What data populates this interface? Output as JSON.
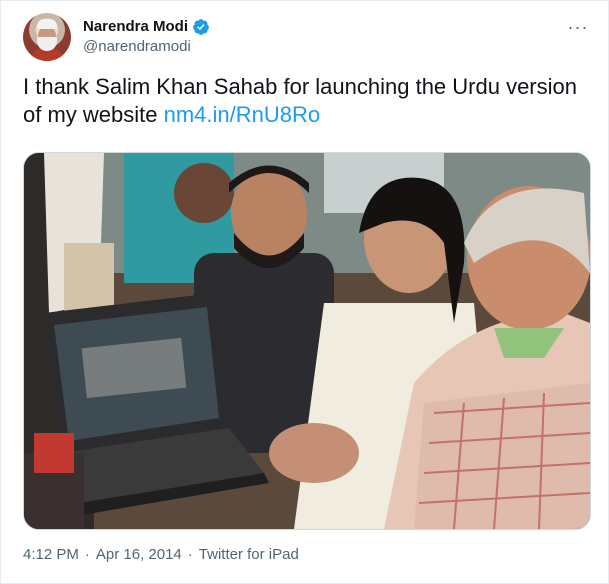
{
  "tweet": {
    "author_name": "Narendra Modi",
    "author_handle": "@narendramodi",
    "text_prefix": "I thank Salim Khan Sahab for launching the Urdu version of my website ",
    "link_text": "nm4.in/RnU8Ro",
    "time": "4:12 PM",
    "date": "Apr 16, 2014",
    "source": "Twitter for iPad",
    "separator": "·",
    "more_glyph": "···"
  },
  "icons": {
    "verified": "verified-badge-icon",
    "more": "more-options-icon"
  },
  "colors": {
    "link": "#1d9bf0",
    "secondary_text": "#536471",
    "verified_badge": "#1d9bf0"
  }
}
